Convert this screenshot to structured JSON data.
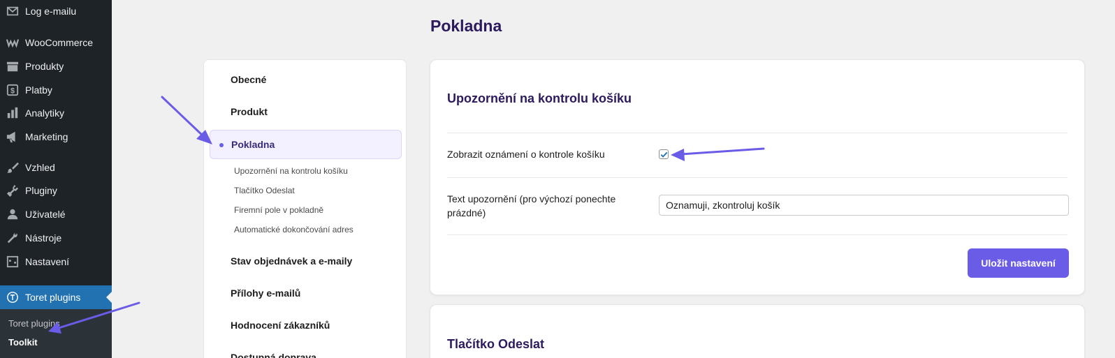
{
  "sidebar": {
    "items": [
      {
        "label": "Log e-mailu",
        "icon": "mail-icon"
      },
      {
        "label": "WooCommerce",
        "icon": "woocommerce-icon"
      },
      {
        "label": "Produkty",
        "icon": "archive-icon"
      },
      {
        "label": "Platby",
        "icon": "dollar-icon"
      },
      {
        "label": "Analytiky",
        "icon": "bar-chart-icon"
      },
      {
        "label": "Marketing",
        "icon": "megaphone-icon"
      },
      {
        "label": "Vzhled",
        "icon": "paintbrush-icon"
      },
      {
        "label": "Pluginy",
        "icon": "plugin-icon"
      },
      {
        "label": "Uživatelé",
        "icon": "user-icon"
      },
      {
        "label": "Nástroje",
        "icon": "wrench-icon"
      },
      {
        "label": "Nastavení",
        "icon": "settings-icon"
      },
      {
        "label": "Toret plugins",
        "icon": "toret-logo-icon"
      }
    ],
    "submenu": [
      "Toret plugins",
      "Toolkit"
    ]
  },
  "page": {
    "title": "Pokladna"
  },
  "settings_nav": {
    "items": [
      "Obecné",
      "Produkt",
      "Pokladna",
      "Stav objednávek a e-maily",
      "Přílohy e-mailů",
      "Hodnocení zákazníků",
      "Dostupná doprava"
    ],
    "sub_items": [
      "Upozornění na kontrolu košíku",
      "Tlačítko Odeslat",
      "Firemní pole v pokladně",
      "Automatické dokončování adres"
    ]
  },
  "card1": {
    "title": "Upozornění na kontrolu košíku",
    "checkbox_label": "Zobrazit oznámení o kontrole košíku",
    "checkbox_checked": true,
    "text_label": "Text upozornění (pro výchozí ponechte prázdné)",
    "text_value": "Oznamuji, zkontroluj košík",
    "save_label": "Uložit nastavení"
  },
  "card2": {
    "title": "Tlačítko Odeslat"
  },
  "colors": {
    "accent": "#6b5ce7",
    "heading": "#2d1a5e",
    "wp_sidebar": "#1d2327",
    "wp_active": "#2271b1"
  }
}
